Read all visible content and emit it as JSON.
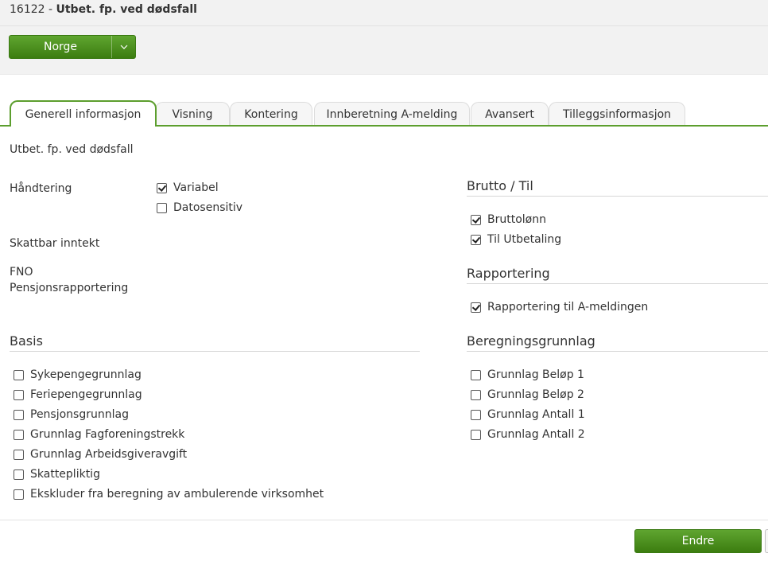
{
  "header": {
    "code": "16122",
    "separator": " - ",
    "title": "Utbet. fp. ved dødsfall"
  },
  "country_button": {
    "label": "Norge",
    "dropdown_icon": "chevron-down-icon"
  },
  "tabs": [
    {
      "label": "Generell informasjon",
      "active": true
    },
    {
      "label": "Visning",
      "active": false
    },
    {
      "label": "Kontering",
      "active": false
    },
    {
      "label": "Innberetning A-melding",
      "active": false
    },
    {
      "label": "Avansert",
      "active": false
    },
    {
      "label": "Tilleggsinformasjon",
      "active": false
    }
  ],
  "general": {
    "description": "Utbet. fp. ved dødsfall",
    "handling_label": "Håndtering",
    "handling_options": [
      {
        "label": "Variabel",
        "checked": true
      },
      {
        "label": "Datosensitiv",
        "checked": false
      }
    ],
    "taxable_income_label": "Skattbar inntekt",
    "fno_label": "FNO",
    "pension_reporting_label": "Pensjonsrapportering"
  },
  "basis": {
    "title": "Basis",
    "items": [
      {
        "label": "Sykepengegrunnlag",
        "checked": false
      },
      {
        "label": "Feriepengegrunnlag",
        "checked": false
      },
      {
        "label": "Pensjonsgrunnlag",
        "checked": false
      },
      {
        "label": "Grunnlag Fagforeningstrekk",
        "checked": false
      },
      {
        "label": "Grunnlag Arbeidsgiveravgift",
        "checked": false
      },
      {
        "label": "Skattepliktig",
        "checked": false
      },
      {
        "label": "Ekskluder fra beregning av ambulerende virksomhet",
        "checked": false
      }
    ]
  },
  "gross": {
    "title": "Brutto / Til",
    "items": [
      {
        "label": "Bruttolønn",
        "checked": true
      },
      {
        "label": "Til Utbetaling",
        "checked": true
      }
    ]
  },
  "reporting": {
    "title": "Rapportering",
    "items": [
      {
        "label": "Rapportering til A-meldingen",
        "checked": true
      }
    ]
  },
  "calc_basis": {
    "title": "Beregningsgrunnlag",
    "items": [
      {
        "label": "Grunnlag Beløp 1",
        "checked": false
      },
      {
        "label": "Grunnlag Beløp 2",
        "checked": false
      },
      {
        "label": "Grunnlag Antall 1",
        "checked": false
      },
      {
        "label": "Grunnlag Antall 2",
        "checked": false
      }
    ]
  },
  "footer": {
    "edit_label": "Endre"
  },
  "colors": {
    "accent": "#5c9e2e",
    "button_top": "#5fa530",
    "button_bottom": "#3c7d10"
  }
}
